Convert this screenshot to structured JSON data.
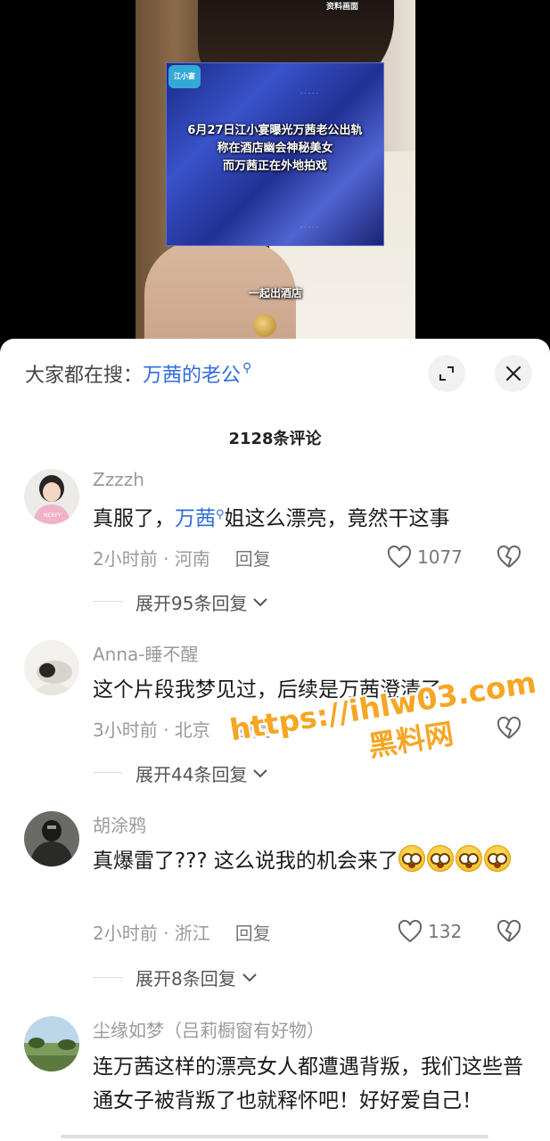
{
  "video": {
    "source_tag": "资料画面",
    "caption_lines": [
      "6月27日江小宴曝光万茜老公出轨",
      "称在酒店幽会神秘美女",
      "而万茜正在外地拍戏"
    ],
    "subtitle": "一起出酒店"
  },
  "search": {
    "prefix": "大家都在搜：",
    "term": "万茜的老公"
  },
  "comments_title": "2128条评论",
  "comments": [
    {
      "user": "Zzzzh",
      "text_before": "真服了，",
      "keyword": "万茜",
      "text_after": "姐这么漂亮，竟然干这事",
      "time_location": "2小时前 · 河南",
      "reply": "回复",
      "likes": "1077",
      "expand": "展开95条回复"
    },
    {
      "user": "Anna-睡不醒",
      "text": "这个片段我梦见过，后续是万茜澄清了",
      "time_location": "3小时前 · 北京",
      "reply": "回复",
      "likes": "",
      "expand": "展开44条回复"
    },
    {
      "user": "胡涂鸦",
      "text": "真爆雷了??? 这么说我的机会来了",
      "time_location": "2小时前 · 浙江",
      "reply": "回复",
      "likes": "132",
      "expand": "展开8条回复"
    },
    {
      "user": "尘缘如梦（吕莉橱窗有好物）",
      "text": "连万茜这样的漂亮女人都遭遇背叛，我们这些普通女子被背叛了也就释怀吧！好好爱自己！"
    }
  ],
  "watermark": {
    "url": "https://ihlw03.com",
    "name": "黑料网"
  },
  "icons": {
    "expand": "expand-icon",
    "close": "close-icon",
    "like": "heart-icon",
    "dislike": "broken-heart-icon",
    "chevron": "chevron-down-icon"
  },
  "colors": {
    "link": "#2f6bd8",
    "watermark": "#f5a623"
  }
}
